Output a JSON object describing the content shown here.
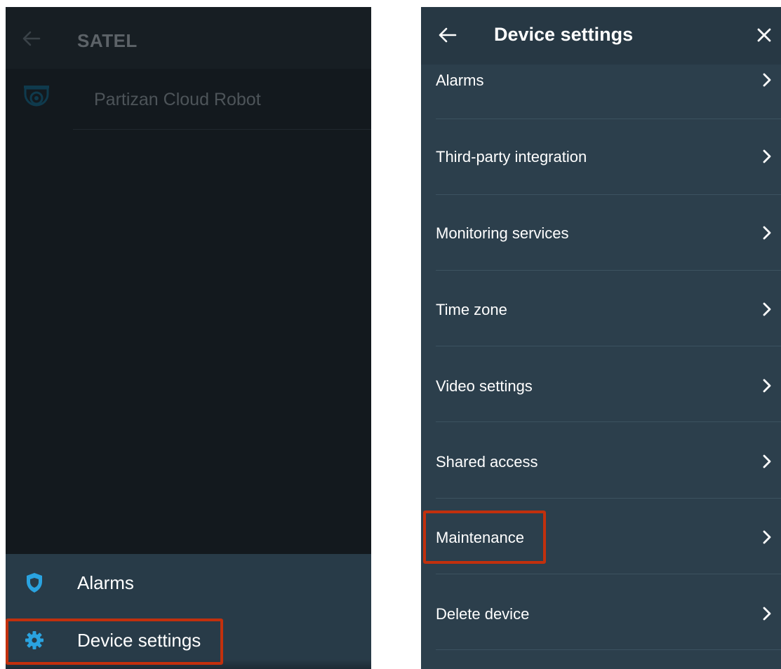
{
  "left_screen": {
    "header": {
      "title": "SATEL",
      "back_icon": "arrow-left-icon"
    },
    "camera_row": {
      "label": "Partizan Cloud Robot",
      "icon": "dome-camera-icon"
    },
    "bottom_menu": [
      {
        "label": "Alarms",
        "icon": "shield-icon",
        "icon_color": "#2aa3e0"
      },
      {
        "label": "Device settings",
        "icon": "gear-icon",
        "icon_color": "#2aa3e0"
      }
    ]
  },
  "right_screen": {
    "header": {
      "title": "Device settings",
      "back_icon": "arrow-left-icon",
      "close_icon": "close-icon"
    },
    "items": [
      {
        "label": "Alarms"
      },
      {
        "label": "Third-party integration"
      },
      {
        "label": "Monitoring services"
      },
      {
        "label": "Time zone"
      },
      {
        "label": "Video settings"
      },
      {
        "label": "Shared access"
      },
      {
        "label": "Maintenance"
      },
      {
        "label": "Delete device"
      }
    ]
  },
  "colors": {
    "highlight": "#c2300d",
    "accent": "#2aa3e0",
    "panel": "#2c3f4c"
  }
}
